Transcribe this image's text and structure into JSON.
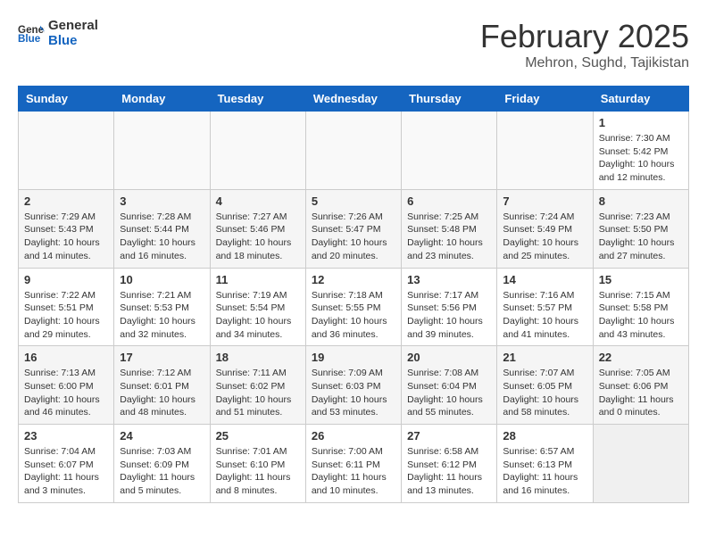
{
  "header": {
    "logo_line1": "General",
    "logo_line2": "Blue",
    "month_year": "February 2025",
    "location": "Mehron, Sughd, Tajikistan"
  },
  "weekdays": [
    "Sunday",
    "Monday",
    "Tuesday",
    "Wednesday",
    "Thursday",
    "Friday",
    "Saturday"
  ],
  "weeks": [
    [
      {
        "day": "",
        "info": ""
      },
      {
        "day": "",
        "info": ""
      },
      {
        "day": "",
        "info": ""
      },
      {
        "day": "",
        "info": ""
      },
      {
        "day": "",
        "info": ""
      },
      {
        "day": "",
        "info": ""
      },
      {
        "day": "1",
        "info": "Sunrise: 7:30 AM\nSunset: 5:42 PM\nDaylight: 10 hours\nand 12 minutes."
      }
    ],
    [
      {
        "day": "2",
        "info": "Sunrise: 7:29 AM\nSunset: 5:43 PM\nDaylight: 10 hours\nand 14 minutes."
      },
      {
        "day": "3",
        "info": "Sunrise: 7:28 AM\nSunset: 5:44 PM\nDaylight: 10 hours\nand 16 minutes."
      },
      {
        "day": "4",
        "info": "Sunrise: 7:27 AM\nSunset: 5:46 PM\nDaylight: 10 hours\nand 18 minutes."
      },
      {
        "day": "5",
        "info": "Sunrise: 7:26 AM\nSunset: 5:47 PM\nDaylight: 10 hours\nand 20 minutes."
      },
      {
        "day": "6",
        "info": "Sunrise: 7:25 AM\nSunset: 5:48 PM\nDaylight: 10 hours\nand 23 minutes."
      },
      {
        "day": "7",
        "info": "Sunrise: 7:24 AM\nSunset: 5:49 PM\nDaylight: 10 hours\nand 25 minutes."
      },
      {
        "day": "8",
        "info": "Sunrise: 7:23 AM\nSunset: 5:50 PM\nDaylight: 10 hours\nand 27 minutes."
      }
    ],
    [
      {
        "day": "9",
        "info": "Sunrise: 7:22 AM\nSunset: 5:51 PM\nDaylight: 10 hours\nand 29 minutes."
      },
      {
        "day": "10",
        "info": "Sunrise: 7:21 AM\nSunset: 5:53 PM\nDaylight: 10 hours\nand 32 minutes."
      },
      {
        "day": "11",
        "info": "Sunrise: 7:19 AM\nSunset: 5:54 PM\nDaylight: 10 hours\nand 34 minutes."
      },
      {
        "day": "12",
        "info": "Sunrise: 7:18 AM\nSunset: 5:55 PM\nDaylight: 10 hours\nand 36 minutes."
      },
      {
        "day": "13",
        "info": "Sunrise: 7:17 AM\nSunset: 5:56 PM\nDaylight: 10 hours\nand 39 minutes."
      },
      {
        "day": "14",
        "info": "Sunrise: 7:16 AM\nSunset: 5:57 PM\nDaylight: 10 hours\nand 41 minutes."
      },
      {
        "day": "15",
        "info": "Sunrise: 7:15 AM\nSunset: 5:58 PM\nDaylight: 10 hours\nand 43 minutes."
      }
    ],
    [
      {
        "day": "16",
        "info": "Sunrise: 7:13 AM\nSunset: 6:00 PM\nDaylight: 10 hours\nand 46 minutes."
      },
      {
        "day": "17",
        "info": "Sunrise: 7:12 AM\nSunset: 6:01 PM\nDaylight: 10 hours\nand 48 minutes."
      },
      {
        "day": "18",
        "info": "Sunrise: 7:11 AM\nSunset: 6:02 PM\nDaylight: 10 hours\nand 51 minutes."
      },
      {
        "day": "19",
        "info": "Sunrise: 7:09 AM\nSunset: 6:03 PM\nDaylight: 10 hours\nand 53 minutes."
      },
      {
        "day": "20",
        "info": "Sunrise: 7:08 AM\nSunset: 6:04 PM\nDaylight: 10 hours\nand 55 minutes."
      },
      {
        "day": "21",
        "info": "Sunrise: 7:07 AM\nSunset: 6:05 PM\nDaylight: 10 hours\nand 58 minutes."
      },
      {
        "day": "22",
        "info": "Sunrise: 7:05 AM\nSunset: 6:06 PM\nDaylight: 11 hours\nand 0 minutes."
      }
    ],
    [
      {
        "day": "23",
        "info": "Sunrise: 7:04 AM\nSunset: 6:07 PM\nDaylight: 11 hours\nand 3 minutes."
      },
      {
        "day": "24",
        "info": "Sunrise: 7:03 AM\nSunset: 6:09 PM\nDaylight: 11 hours\nand 5 minutes."
      },
      {
        "day": "25",
        "info": "Sunrise: 7:01 AM\nSunset: 6:10 PM\nDaylight: 11 hours\nand 8 minutes."
      },
      {
        "day": "26",
        "info": "Sunrise: 7:00 AM\nSunset: 6:11 PM\nDaylight: 11 hours\nand 10 minutes."
      },
      {
        "day": "27",
        "info": "Sunrise: 6:58 AM\nSunset: 6:12 PM\nDaylight: 11 hours\nand 13 minutes."
      },
      {
        "day": "28",
        "info": "Sunrise: 6:57 AM\nSunset: 6:13 PM\nDaylight: 11 hours\nand 16 minutes."
      },
      {
        "day": "",
        "info": ""
      }
    ]
  ]
}
